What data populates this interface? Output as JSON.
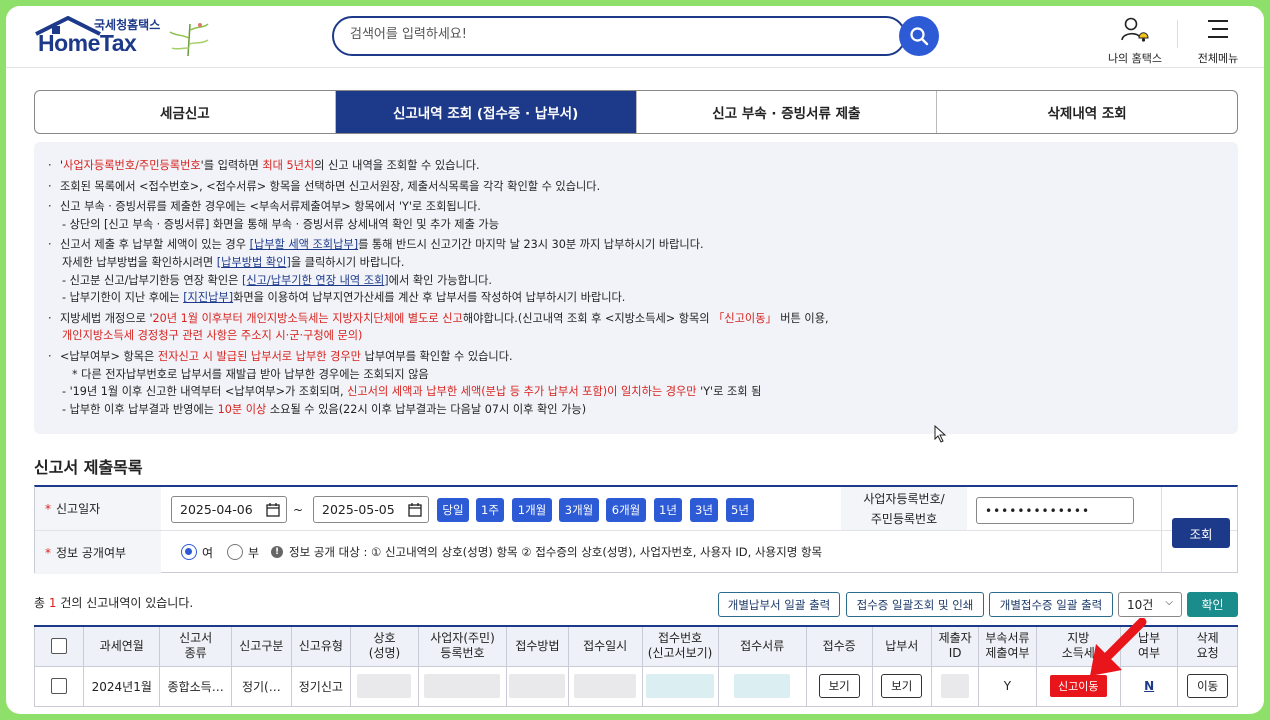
{
  "header": {
    "logo_sub": "국세청홈택스",
    "logo_main": "HomeTax",
    "search_placeholder": "검색어를 입력하세요!",
    "my_hometax": "나의 홈택스",
    "menu": "전체메뉴"
  },
  "tabs": [
    {
      "label": "세금신고"
    },
    {
      "label": "신고내역 조회 (접수증 · 납부서)"
    },
    {
      "label": "신고 부속 · 증빙서류 제출"
    },
    {
      "label": "삭제내역 조회"
    }
  ],
  "notice": {
    "l1a": "'",
    "l1b": "사업자등록번호/주민등록번호",
    "l1c": "'를 입력하면 ",
    "l1d": "최대 5년치",
    "l1e": "의 신고 내역을 조회할 수 있습니다.",
    "l2": "조회된 목록에서 <접수번호>, <접수서류> 항목을 선택하면 신고서원장, 제출서식목록을 각각 확인할 수 있습니다.",
    "l3": "신고 부속 · 증빙서류를 제출한 경우에는 <부속서류제출여부> 항목에서 'Y'로 조회됩니다.",
    "l3s": "- 상단의 [신고 부속 · 증빙서류] 화면을 통해 부속 · 증빙서류 상세내역 확인 및 추가 제출 가능",
    "l4a": "신고서 제출 후 납부할 세액이 있는 경우 ",
    "l4b": "[납부할 세액 조회납부]",
    "l4c": "를 통해 반드시 신고기간 마지막 날 23시 30분 까지 납부하시기 바랍니다.",
    "l4d": "자세한 납부방법을 확인하시려면 ",
    "l4e": "[납부방법 확인]",
    "l4f": "을 클릭하시기 바랍니다.",
    "l4g": "- 신고분 신고/납부기한등 연장 확인은 ",
    "l4h": "[신고/납부기한 연장 내역 조회]",
    "l4i": "에서 확인 가능합니다.",
    "l4j": "- 납부기한이 지난 후에는 ",
    "l4k": "[지진납부]",
    "l4l": "화면을 이용하여 납부지연가산세를 계산 후 납부서를 작성하여 납부하시기 바랍니다.",
    "l5a": "지방세법 개정으로 '",
    "l5b": "20년 1월 이후부터 개인지방소득세는 지방자치단체에 별도로 신고",
    "l5c": "해야합니다.(신고내역 조회 후 <지방소득세> 항목의 ",
    "l5d": "「신고이동」",
    "l5e": " 버튼 이용,",
    "l5f": "개인지방소득세 경정청구 관련 사항은 주소지 시·군·구청에 문의)",
    "l6a": "<납부여부> 항목은 ",
    "l6b": "전자신고 시 발급된 납부서로 납부한 경우만",
    "l6c": " 납부여부를 확인할 수 있습니다.",
    "l6d": "* 다른 전자납부번호로 납부서를 재발급 받아 납부한 경우에는 조회되지 않음",
    "l6e": "- '19년 1월 이후 신고한 내역부터 <납부여부>가 조회되며, ",
    "l6f": "신고서의 세액과 납부한 세액(분납 등 추가 납부서 포함)이 일치하는 경우만",
    "l6g": " 'Y'로 조회 됨",
    "l6h": "- 납부한 이후 납부결과 반영에는 ",
    "l6i": "10분 이상",
    "l6j": " 소요될 수 있음(22시 이후 납부결과는 다음날 07시 이후 확인 가능)"
  },
  "section_title": "신고서 제출목록",
  "filter": {
    "date_label": "신고일자",
    "date_from": "2025-04-06",
    "tilde": "~",
    "date_to": "2025-05-05",
    "periods": [
      "당일",
      "1주",
      "1개월",
      "3개월",
      "6개월",
      "1년",
      "3년",
      "5년"
    ],
    "biz_label_1": "사업자등록번호/",
    "biz_label_2": "주민등록번호",
    "biz_value": "•••••••••••••",
    "submit": "조회",
    "public_label": "정보 공개여부",
    "yes": "여",
    "no": "부",
    "info_icon": "!",
    "public_info": "정보 공개 대상 : ① 신고내역의 상호(성명) 항목 ② 접수증의 상호(성명), 사업자번호, 사용자 ID, 사용지명 항목"
  },
  "results": {
    "count_a": "총 ",
    "count_n": "1",
    "count_b": " 건의 신고내역이 있습니다.",
    "buttons": [
      "개별납부서 일괄 출력",
      "접수증 일괄조회 및 인쇄",
      "개별접수증 일괄 출력"
    ],
    "page_size": "10건",
    "confirm": "확인"
  },
  "table": {
    "headers": [
      "",
      "과세연월",
      "신고서\n종류",
      "신고구분",
      "신고유형",
      "상호\n(성명)",
      "사업자(주민)\n등록번호",
      "접수방법",
      "접수일시",
      "접수번호\n(신고서보기)",
      "접수서류",
      "접수증",
      "납부서",
      "제출자\nID",
      "부속서류\n제출여부",
      "지방\n소득세",
      "납부\n여부",
      "삭제\n요청"
    ],
    "row": {
      "period": "2024년1월",
      "type": "종합소득…",
      "category": "정기(…",
      "kind": "정기신고",
      "receipt": "보기",
      "payslip": "보기",
      "attach": "Y",
      "local_tax": "신고이동",
      "paid": "N",
      "delete": "이동"
    }
  },
  "colors": {
    "brand": "#1d3a8a",
    "accent": "#2d5bd6",
    "red": "#e8151b",
    "border_green": "#8fe06a"
  }
}
